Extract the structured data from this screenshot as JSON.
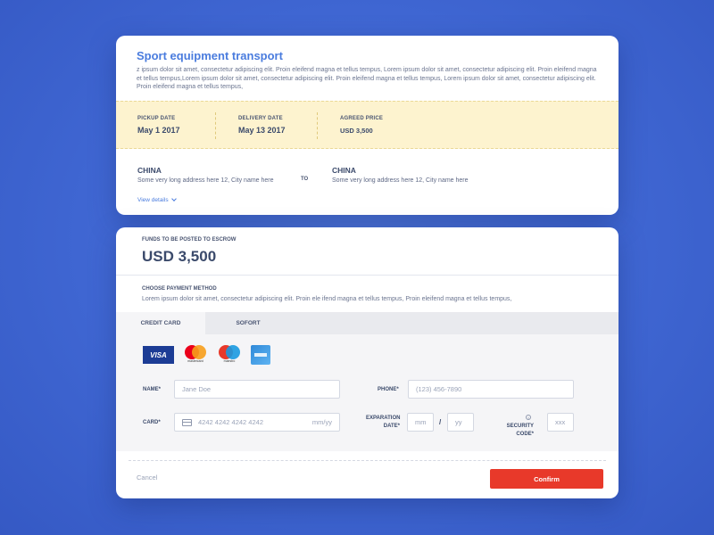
{
  "shipment": {
    "title": "Sport equipment transport",
    "description": "z ipsum dolor sit amet, consectetur adipiscing elit. Proin eleifend magna et tellus tempus, Lorem ipsum dolor sit amet, consectetur adipiscing elit. Proin eleifend magna et tellus tempus,Lorem ipsum dolor sit amet, consectetur adipiscing elit. Proin eleifend magna et tellus tempus, Lorem ipsum dolor sit amet, consectetur adipiscing elit. Proin eleifend magna et tellus tempus,",
    "pickup_label": "PICKUP DATE",
    "pickup_value": "May 1 2017",
    "delivery_label": "DELIVERY DATE",
    "delivery_value": "May 13 2017",
    "price_label": "AGREED PRICE",
    "price_value": "USD 3,500",
    "from": {
      "country": "CHINA",
      "address": "Some very long address here 12, City name here"
    },
    "to_label": "TO",
    "to": {
      "country": "CHINA",
      "address": "Some very long address here 12, City name here"
    },
    "view_details": "View details"
  },
  "payment": {
    "funds_label": "FUNDS TO BE POSTED TO ESCROW",
    "funds_value": "USD 3,500",
    "method_label": "CHOOSE PAYMENT METHOD",
    "method_desc": "Lorem ipsum dolor sit amet, consectetur adipiscing elit. Proin ele ifend magna et tellus tempus, Proin eleifend magna et tellus tempus,",
    "tabs": [
      {
        "label": "CREDIT CARD",
        "active": true
      },
      {
        "label": "SOFORT",
        "active": false
      }
    ],
    "card_brands": {
      "visa": "VISA",
      "mastercard": "mastercard",
      "maestro": "maestro"
    },
    "fields": {
      "name_label": "NAME*",
      "name_placeholder": "Jane Doe",
      "phone_label": "PHONE*",
      "phone_placeholder": "(123) 456-7890",
      "card_label": "CARD*",
      "card_placeholder": "4242 4242 4242 4242",
      "card_expiry_placeholder": "mm/yy",
      "expiration_label_1": "EXPARATION",
      "expiration_label_2": "DATE*",
      "exp_month_placeholder": "mm",
      "exp_separator": "/",
      "exp_year_placeholder": "yy",
      "security_label_1": "SECURITY",
      "security_label_2": "CODE*",
      "security_placeholder": "xxx"
    },
    "cancel_label": "Cancel",
    "confirm_label": "Confirm"
  },
  "colors": {
    "accent": "#4a7cde",
    "confirm": "#e8392a",
    "highlight_band": "#fdf3cf",
    "background": "#4268d4"
  }
}
